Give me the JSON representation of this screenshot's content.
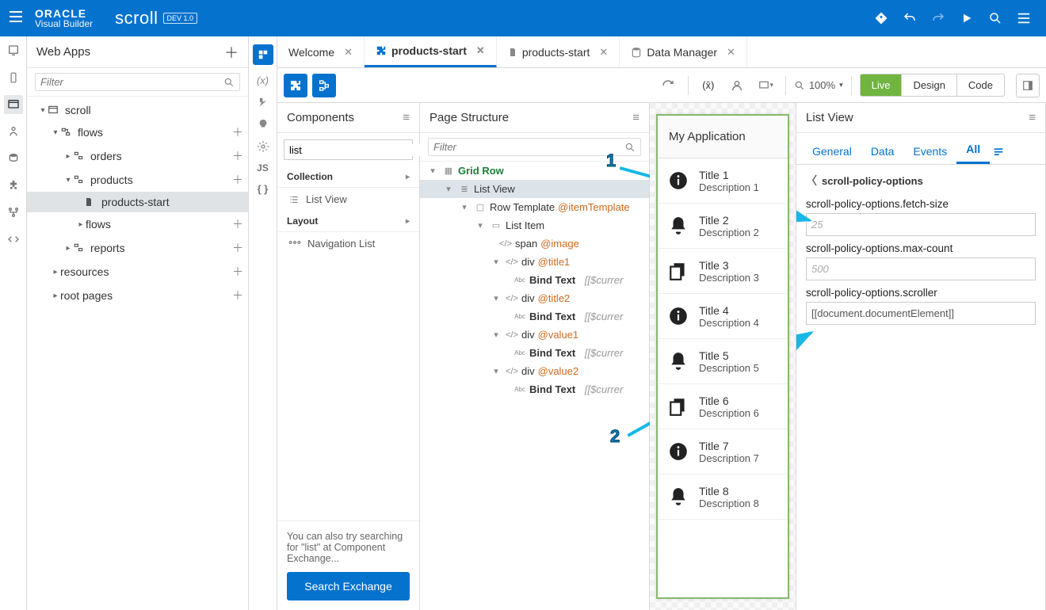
{
  "header": {
    "brand_top": "ORACLE",
    "brand_bottom": "Visual Builder",
    "app_name": "scroll",
    "badge": "DEV 1.0"
  },
  "webapps": {
    "title": "Web Apps",
    "filter_placeholder": "Filter",
    "tree": {
      "root": "scroll",
      "flows": "flows",
      "orders": "orders",
      "products": "products",
      "products_start": "products-start",
      "flows2": "flows",
      "reports": "reports",
      "resources": "resources",
      "rootpages": "root pages"
    }
  },
  "tabs": [
    {
      "label": "Welcome",
      "icon": "",
      "closable": true
    },
    {
      "label": "products-start",
      "icon": "puzzle",
      "closable": true,
      "active": true
    },
    {
      "label": "products-start",
      "icon": "page",
      "closable": true
    },
    {
      "label": "Data Manager",
      "icon": "db",
      "closable": true
    }
  ],
  "toolbar": {
    "zoom": "100%",
    "modes": {
      "live": "Live",
      "design": "Design",
      "code": "Code"
    }
  },
  "components": {
    "title": "Components",
    "search_value": "list",
    "section_collection": "Collection",
    "item_listview": "List View",
    "section_layout": "Layout",
    "item_navlist": "Navigation List",
    "foot_text": "You can also try searching for \"list\" at Component Exchange...",
    "foot_btn": "Search Exchange"
  },
  "pagestruct": {
    "title": "Page Structure",
    "filter_placeholder": "Filter",
    "nodes": {
      "gridrow": "Grid Row",
      "listview": "List View",
      "rowtpl": "Row Template",
      "rowtpl_slot": "@itemTemplate",
      "listitem": "List Item",
      "span": "span",
      "span_slot": "@image",
      "div": "div",
      "title1": "@title1",
      "title2": "@title2",
      "value1": "@value1",
      "value2": "@value2",
      "bindtext": "Bind Text",
      "expr": "[[$currer"
    }
  },
  "canvas": {
    "app_title": "My Application",
    "items": [
      {
        "title": "Title 1",
        "desc": "Description 1",
        "icon": "info"
      },
      {
        "title": "Title 2",
        "desc": "Description 2",
        "icon": "bell"
      },
      {
        "title": "Title 3",
        "desc": "Description 3",
        "icon": "copy"
      },
      {
        "title": "Title 4",
        "desc": "Description 4",
        "icon": "info"
      },
      {
        "title": "Title 5",
        "desc": "Description 5",
        "icon": "bell"
      },
      {
        "title": "Title 6",
        "desc": "Description 6",
        "icon": "copy"
      },
      {
        "title": "Title 7",
        "desc": "Description 7",
        "icon": "info"
      },
      {
        "title": "Title 8",
        "desc": "Description 8",
        "icon": "bell"
      }
    ]
  },
  "props": {
    "title": "List View",
    "tabs": {
      "general": "General",
      "data": "Data",
      "events": "Events",
      "all": "All"
    },
    "crumb": "scroll-policy-options",
    "fields": [
      {
        "label": "scroll-policy-options.fetch-size",
        "value": "",
        "placeholder": "25"
      },
      {
        "label": "scroll-policy-options.max-count",
        "value": "",
        "placeholder": "500"
      },
      {
        "label": "scroll-policy-options.scroller",
        "value": "[[document.documentElement]]",
        "placeholder": ""
      }
    ]
  },
  "annotations": {
    "n1": "1",
    "n2": "2"
  }
}
